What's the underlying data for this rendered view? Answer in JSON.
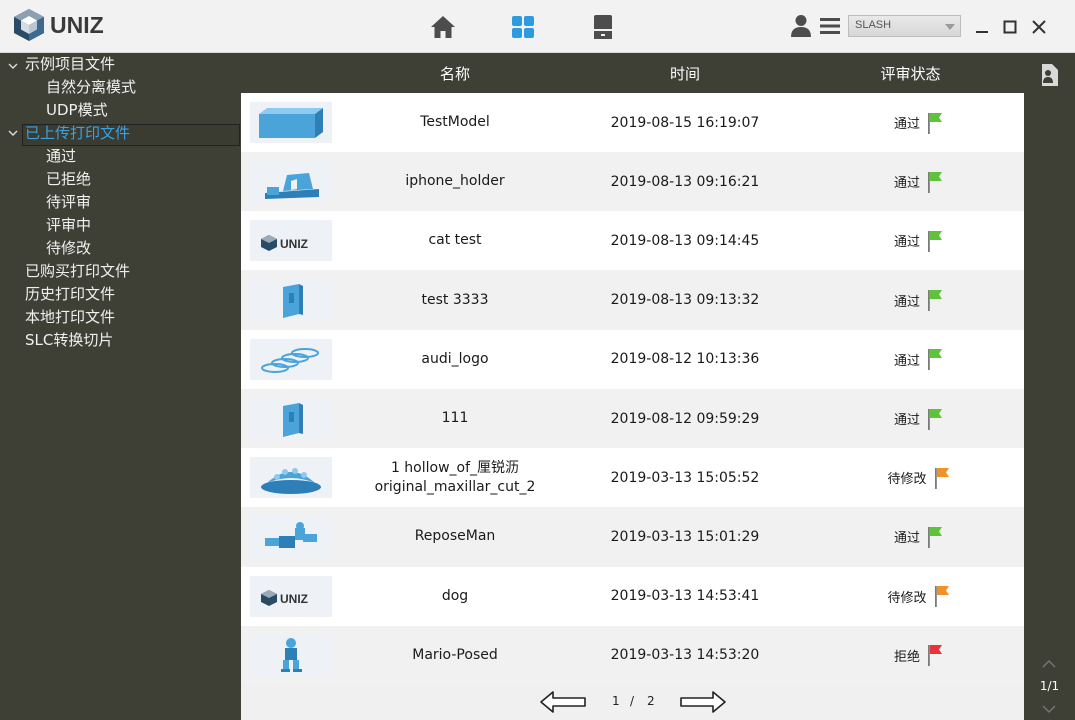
{
  "app": {
    "logo_text": "UNIZ",
    "nav": [
      "home-icon",
      "grid-icon",
      "printer-icon"
    ],
    "printer_select": "SLASH"
  },
  "sidebar": {
    "groups": [
      {
        "label": "示例项目文件",
        "expanded": true,
        "children": [
          "自然分离模式",
          "UDP模式"
        ]
      },
      {
        "label": "已上传打印文件",
        "expanded": true,
        "selected": true,
        "children": [
          "通过",
          "已拒绝",
          "待评审",
          "评审中",
          "待修改"
        ]
      },
      {
        "label": "已购买打印文件"
      },
      {
        "label": "历史打印文件"
      },
      {
        "label": "本地打印文件"
      },
      {
        "label": "SLC转换切片"
      }
    ]
  },
  "table": {
    "headers": {
      "name": "名称",
      "time": "时间",
      "status": "评审状态"
    },
    "rows": [
      {
        "thumb": "box-model",
        "name": "TestModel",
        "time": "2019-08-15 16:19:07",
        "status": "通过",
        "flag": "#5ec23a"
      },
      {
        "thumb": "holder-model",
        "name": "iphone_holder",
        "time": "2019-08-13 09:16:21",
        "status": "通过",
        "flag": "#5ec23a"
      },
      {
        "thumb": "uniz-logo",
        "name": "cat test",
        "time": "2019-08-13 09:14:45",
        "status": "通过",
        "flag": "#5ec23a"
      },
      {
        "thumb": "block-model",
        "name": "test 3333",
        "time": "2019-08-13 09:13:32",
        "status": "通过",
        "flag": "#5ec23a"
      },
      {
        "thumb": "rings-model",
        "name": "audi_logo",
        "time": "2019-08-12 10:13:36",
        "status": "通过",
        "flag": "#5ec23a"
      },
      {
        "thumb": "block-model",
        "name": "111",
        "time": "2019-08-12 09:59:29",
        "status": "通过",
        "flag": "#5ec23a"
      },
      {
        "thumb": "teeth-model",
        "name": "1 hollow_of_厘锐沥",
        "name2": "original_maxillar_cut_2",
        "time": "2019-03-13 15:05:52",
        "status": "待修改",
        "flag": "#f0922a"
      },
      {
        "thumb": "figure-model",
        "name": "ReposeMan",
        "time": "2019-03-13 15:01:29",
        "status": "通过",
        "flag": "#5ec23a"
      },
      {
        "thumb": "uniz-logo",
        "name": "dog",
        "time": "2019-03-13 14:53:41",
        "status": "待修改",
        "flag": "#f0922a"
      },
      {
        "thumb": "mario-model",
        "name": "Mario-Posed",
        "time": "2019-03-13 14:53:20",
        "status": "拒绝",
        "flag": "#e8333a"
      }
    ]
  },
  "pager": {
    "current": "1",
    "sep": "/",
    "total": "2"
  },
  "rail": {
    "page": "1/1"
  },
  "colors": {
    "accent": "#3aa2e3",
    "dark": "#3e3f35",
    "model_blue": "#4aa3d9"
  }
}
